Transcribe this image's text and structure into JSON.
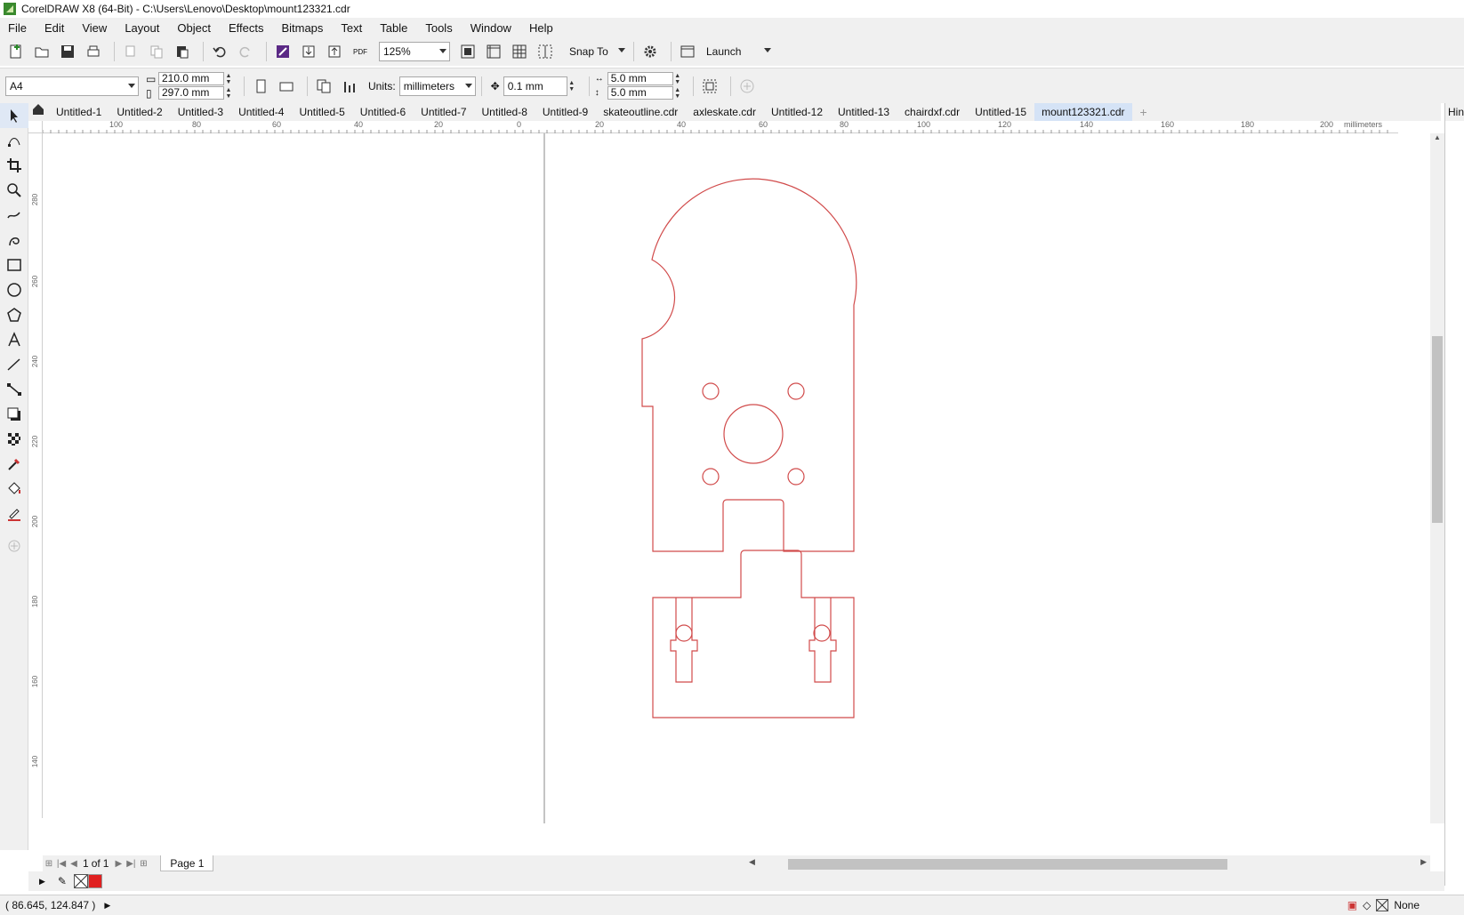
{
  "window": {
    "title": "CorelDRAW X8 (64-Bit) - C:\\Users\\Lenovo\\Desktop\\mount123321.cdr"
  },
  "menu": [
    "File",
    "Edit",
    "View",
    "Layout",
    "Object",
    "Effects",
    "Bitmaps",
    "Text",
    "Table",
    "Tools",
    "Window",
    "Help"
  ],
  "toolbar": {
    "zoom": "125%",
    "snap_label": "Snap To",
    "launch_label": "Launch",
    "pdf_label": "PDF"
  },
  "property_bar": {
    "page_size": "A4",
    "width": "210.0 mm",
    "height": "297.0 mm",
    "units_label": "Units:",
    "units": "millimeters",
    "nudge": "0.1 mm",
    "dup_x": "5.0 mm",
    "dup_y": "5.0 mm"
  },
  "tabs": [
    "Untitled-1",
    "Untitled-2",
    "Untitled-3",
    "Untitled-4",
    "Untitled-5",
    "Untitled-6",
    "Untitled-7",
    "Untitled-8",
    "Untitled-9",
    "skateoutline.cdr",
    "axleskate.cdr",
    "Untitled-12",
    "Untitled-13",
    "chairdxf.cdr",
    "Untitled-15",
    "mount123321.cdr"
  ],
  "active_tab": "mount123321.cdr",
  "ruler_h": [
    "100",
    "80",
    "60",
    "40",
    "20",
    "0",
    "20",
    "40",
    "60",
    "80",
    "100",
    "120",
    "140",
    "160",
    "180",
    "200"
  ],
  "ruler_units": "millimeters",
  "ruler_v": [
    "280",
    "260",
    "240",
    "220",
    "200",
    "180",
    "160",
    "140"
  ],
  "page_nav": {
    "position": "1",
    "of": "of",
    "total": "1",
    "page_label": "Page 1"
  },
  "status": {
    "coords": "( 86.645, 124.847 )",
    "fill": "None"
  },
  "right_panel": {
    "label": "Hin"
  },
  "colors": {
    "outline": "#d14b4b",
    "accent_tab": "#d5e3f6",
    "swatch": "#e02020"
  }
}
